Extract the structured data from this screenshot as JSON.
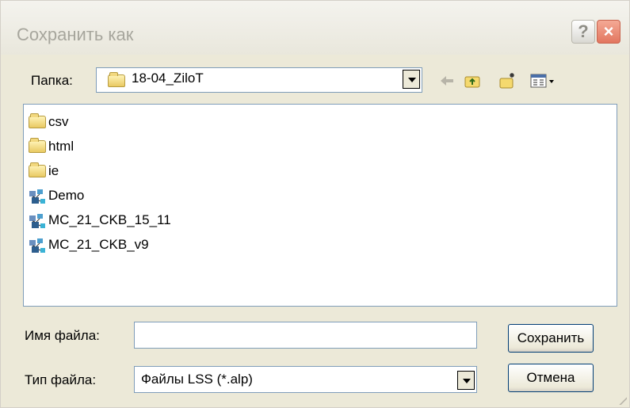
{
  "window": {
    "title": "Сохранить как",
    "help_label": "?",
    "close_label": "×"
  },
  "toolbar": {
    "folder_label": "Папка:",
    "current_folder": "18-04_ZiloT"
  },
  "files": [
    {
      "name": "csv",
      "icon": "folder-icon"
    },
    {
      "name": "html",
      "icon": "folder-icon"
    },
    {
      "name": "ie",
      "icon": "folder-icon"
    },
    {
      "name": "Demo",
      "icon": "lss-file-icon"
    },
    {
      "name": "MC_21_CKB_15_11",
      "icon": "lss-file-icon"
    },
    {
      "name": "MC_21_CKB_v9",
      "icon": "lss-file-icon"
    }
  ],
  "form": {
    "filename_label": "Имя файла:",
    "filename_value": "",
    "filetype_label": "Тип файла:",
    "filetype_value": "Файлы LSS (*.alp)",
    "save_label": "Сохранить",
    "cancel_label": "Отмена"
  }
}
